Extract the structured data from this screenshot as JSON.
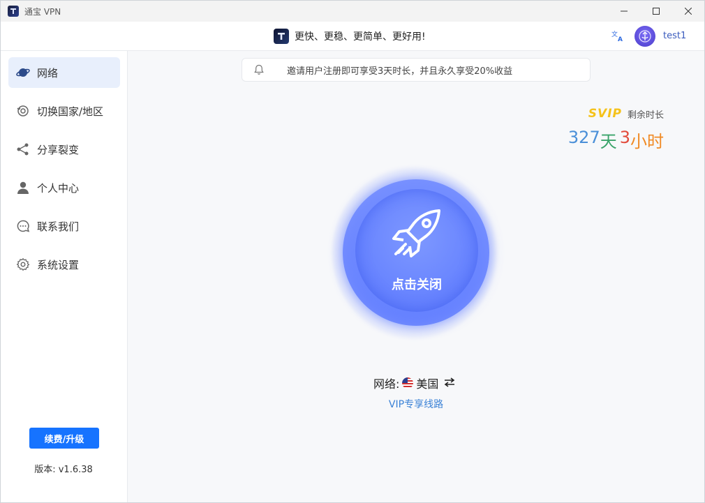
{
  "window": {
    "title": "通宝 VPN",
    "controls": [
      "minimize",
      "maximize",
      "close"
    ]
  },
  "header": {
    "slogan": "更快、更稳、更简单、更好用!",
    "username": "test1"
  },
  "sidebar": {
    "items": [
      {
        "label": "网络",
        "icon": "planet-icon",
        "active": true
      },
      {
        "label": "切换国家/地区",
        "icon": "globe-switch-icon",
        "active": false
      },
      {
        "label": "分享裂变",
        "icon": "share-icon",
        "active": false
      },
      {
        "label": "个人中心",
        "icon": "user-icon",
        "active": false
      },
      {
        "label": "联系我们",
        "icon": "chat-icon",
        "active": false
      },
      {
        "label": "系统设置",
        "icon": "gear-icon",
        "active": false
      }
    ],
    "renew_button": "续费/升级",
    "version": "版本: v1.6.38"
  },
  "main": {
    "notice": "邀请用户注册即可享受3天时长，并且永久享受20%收益",
    "svip_badge": "SVIP",
    "remaining_label": "剩余时长",
    "remaining": {
      "days_num": "327",
      "days_unit": "天",
      "hours_num": "3",
      "hours_unit": "小时"
    },
    "connect_button": "点击关闭",
    "network_label": "网络:",
    "network_country": "美国",
    "vip_line": "VIP专享线路"
  },
  "colors": {
    "accent": "#1673ff",
    "svip": "#f5c21b",
    "orb": "#6a86ff"
  }
}
